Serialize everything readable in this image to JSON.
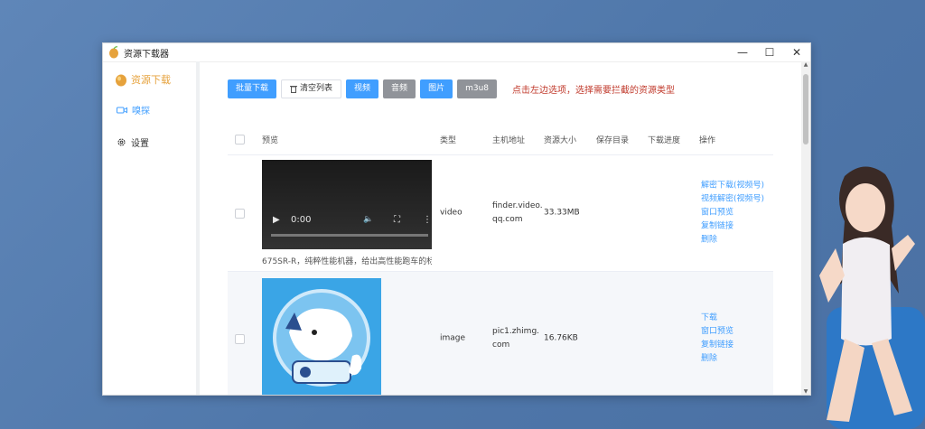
{
  "window": {
    "title": "资源下载器",
    "controls": {
      "minimize": "—",
      "maximize": "☐",
      "close": "✕"
    }
  },
  "sidebar": {
    "brand": "资源下载",
    "items": [
      {
        "label": "嗅探",
        "icon": "video-camera-icon",
        "active": true
      },
      {
        "label": "设置",
        "icon": "gear-icon",
        "active": false
      }
    ]
  },
  "toolbar": {
    "batch_download": "批量下载",
    "clear_list": "清空列表",
    "filters": [
      "视频",
      "音频",
      "图片",
      "m3u8"
    ],
    "hint": "点击左边选项，选择需要拦截的资源类型"
  },
  "table": {
    "headers": [
      "预览",
      "类型",
      "主机地址",
      "资源大小",
      "保存目录",
      "下载进度",
      "操作"
    ],
    "rows": [
      {
        "preview": {
          "kind": "video",
          "time": "0:00",
          "caption": "675SR-R，纯粹性能机器，给出高性能跑车的标"
        },
        "type": "video",
        "host": "finder.video.qq.com",
        "size": "33.33MB",
        "save_dir": "",
        "progress": "",
        "actions": [
          "解密下载(视频号)",
          "视频解密(视频号)",
          "窗口预览",
          "复制链接",
          "删除"
        ]
      },
      {
        "preview": {
          "kind": "image"
        },
        "type": "image",
        "host": "pic1.zhimg.com",
        "size": "16.76KB",
        "save_dir": "",
        "progress": "",
        "actions": [
          "下载",
          "窗口预览",
          "复制链接",
          "删除"
        ]
      }
    ]
  },
  "colors": {
    "primary": "#409eff",
    "gray": "#909399",
    "hint": "#c0392b",
    "brand": "#e6a23c"
  }
}
